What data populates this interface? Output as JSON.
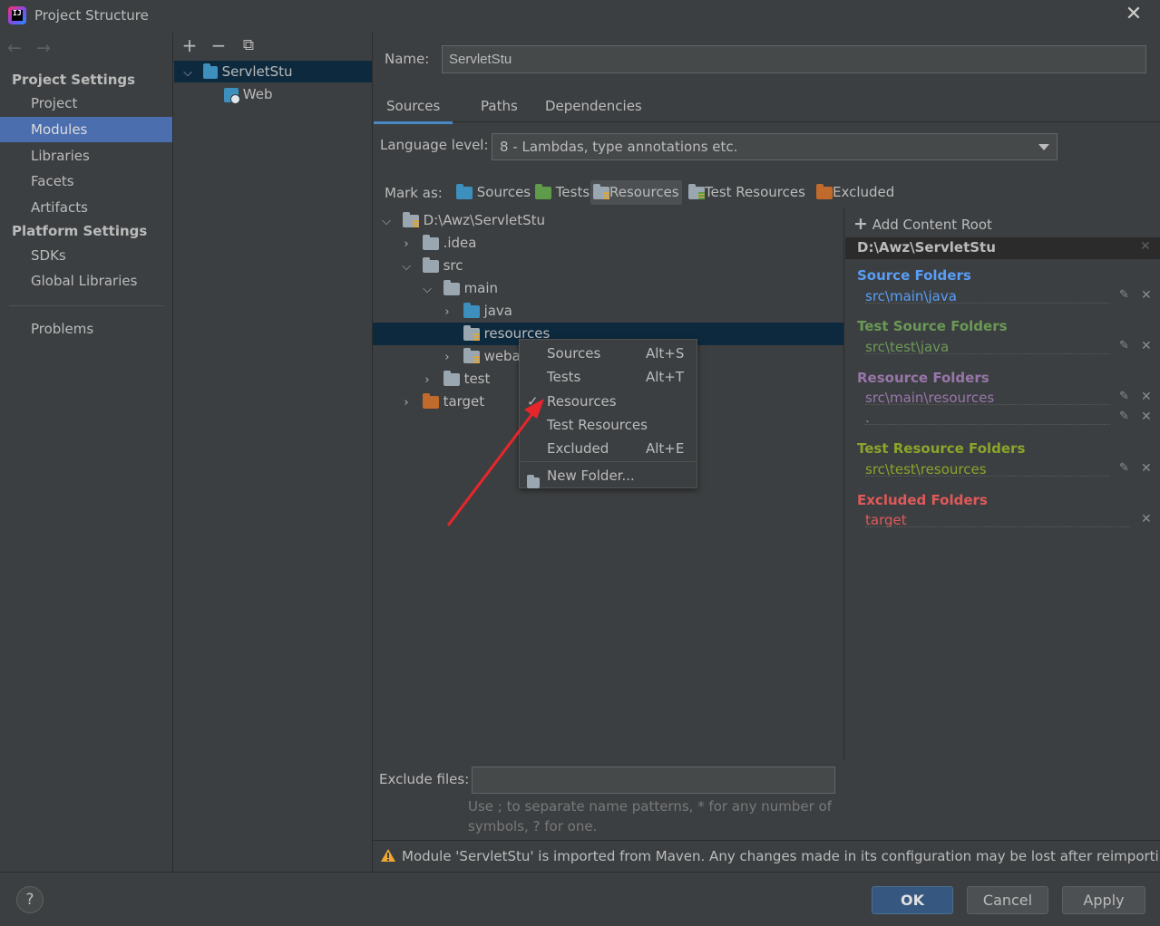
{
  "window": {
    "title": "Project Structure",
    "close": "✕"
  },
  "nav": {
    "back": "←",
    "forward": "→",
    "project_settings": "Project Settings",
    "items_ps": [
      "Project",
      "Modules",
      "Libraries",
      "Facets",
      "Artifacts"
    ],
    "platform_settings": "Platform Settings",
    "items_pl": [
      "SDKs",
      "Global Libraries"
    ],
    "problems": "Problems",
    "selected": "Modules"
  },
  "modules_toolbar": {
    "add": "+",
    "remove": "−",
    "copy": "⧉"
  },
  "modules": {
    "root": "ServletStu",
    "child": "Web"
  },
  "name_field": {
    "label": "Name:",
    "value": "ServletStu"
  },
  "tabs": [
    "Sources",
    "Paths",
    "Dependencies"
  ],
  "active_tab": "Sources",
  "language": {
    "label": "Language level:",
    "value": "8 - Lambdas, type annotations etc."
  },
  "mark_as": {
    "label": "Mark as:",
    "buttons": [
      "Sources",
      "Tests",
      "Resources",
      "Test Resources",
      "Excluded"
    ],
    "active": "Resources"
  },
  "tree": {
    "root": "D:\\Awz\\ServletStu",
    "idea": ".idea",
    "src": "src",
    "main": "main",
    "java": "java",
    "resources": "resources",
    "webapp": "weba",
    "test": "test",
    "target": "target"
  },
  "context_menu": {
    "items": [
      {
        "label": "Sources",
        "shortcut": "Alt+S"
      },
      {
        "label": "Tests",
        "shortcut": "Alt+T"
      },
      {
        "label": "Resources",
        "shortcut": ""
      },
      {
        "label": "Test Resources",
        "shortcut": ""
      },
      {
        "label": "Excluded",
        "shortcut": "Alt+E"
      }
    ],
    "checked": "Resources",
    "new_folder": "New Folder..."
  },
  "exclude": {
    "label": "Exclude files:",
    "value": "",
    "hint1": "Use ; to separate name patterns, * for any number of",
    "hint2": "symbols, ? for one."
  },
  "right_panel": {
    "add_content_root": "Add Content Root",
    "root_path": "D:\\Awz\\ServletStu",
    "source_folders": {
      "title": "Source Folders",
      "paths": [
        "src\\main\\java"
      ]
    },
    "test_source_folders": {
      "title": "Test Source Folders",
      "paths": [
        "src\\test\\java"
      ]
    },
    "resource_folders": {
      "title": "Resource Folders",
      "paths": [
        "src\\main\\resources",
        "."
      ]
    },
    "test_resource_folders": {
      "title": "Test Resource Folders",
      "paths": [
        "src\\test\\resources"
      ]
    },
    "excluded_folders": {
      "title": "Excluded Folders",
      "paths": [
        "target"
      ]
    }
  },
  "warning": "Module 'ServletStu' is imported from Maven. Any changes made in its configuration may be lost after reimporting.",
  "buttons": {
    "help": "?",
    "ok": "OK",
    "cancel": "Cancel",
    "apply": "Apply"
  },
  "colors": {
    "accent": "#4b6eaf",
    "source": "#589df6",
    "test_source": "#6a9955",
    "resource": "#9876aa",
    "test_resource": "#8aa52b",
    "excluded": "#e0595a",
    "arrow": "#e8262a"
  }
}
